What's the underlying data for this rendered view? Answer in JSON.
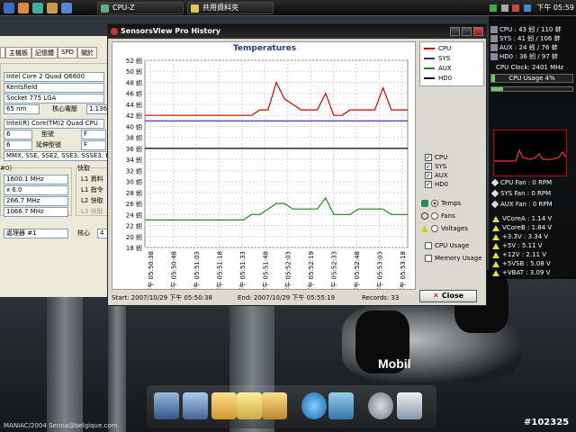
{
  "taskbar": {
    "tasks": [
      {
        "label": "CPU-Z"
      },
      {
        "label": "共用資料夾"
      }
    ],
    "clock": "下午 05:59"
  },
  "cpuz": {
    "tabs": [
      "主機板",
      "記憶體",
      "SPD",
      "關於"
    ],
    "name": "Intel Core 2 Quad Q6600",
    "codename": "Kentsfield",
    "package": "Socket 775 LGA",
    "technology": "65 nm",
    "voltage_label": "核心電壓",
    "voltage": "1.136",
    "spec": "Intel(R) Core(TM)2 Quad CPU",
    "family": "6",
    "model_label": "型號",
    "model": "F",
    "ext_family": "6",
    "ext_model_label": "延伸型號",
    "ext_model": "F",
    "instructions": "MMX, SSE, SSE2, SSE3, SSSE3, EM",
    "group_clocks": "#0)",
    "group_cache": "快取",
    "core_speed": "1600.1 MHz",
    "multiplier": "x 6.0",
    "bus_speed": "266.7 MHz",
    "rated_fsb": "1066.7 MHz",
    "l1_data_label": "L1 資料",
    "l1_inst_label": "L1 指令",
    "l2_label": "L2 快取",
    "l3_label": "L3 快取",
    "processor_select": "處理器 #1",
    "cores_label": "核心",
    "cores_value": "4"
  },
  "sensorsview": {
    "title": "SensorsView Pro History",
    "chart_title": "Temperatures",
    "legend": [
      "CPU",
      "SYS",
      "AUX",
      "HD0"
    ],
    "checks": [
      "CPU",
      "SYS",
      "AUX",
      "HD0"
    ],
    "radios": [
      "Temps",
      "Fans",
      "Voltages"
    ],
    "options": [
      "CPU Usage",
      "Memory Usage"
    ],
    "close_label": "Close",
    "start_label": "Start: 2007/10/29 下午 05:50:38",
    "end_label": "End: 2007/10/29 下午 05:55:19",
    "records_label": "Records: 33"
  },
  "chart_data": {
    "type": "line",
    "title": "Temperatures",
    "ylim": [
      18,
      52
    ],
    "y_ticks": [
      "52 蚓",
      "50 蚓",
      "48 蚓",
      "46 蚓",
      "44 蚓",
      "42 蚓",
      "40 蚓",
      "38 蚓",
      "36 蚓",
      "34 蚓",
      "32 蚓",
      "30 蚓",
      "28 蚓",
      "26 蚓",
      "24 蚓",
      "22 蚓",
      "20 蚓",
      "18 蚓"
    ],
    "x_ticks": [
      "下午 05:50:38",
      "下午 05:50:48",
      "下午 05:51:03",
      "下午 05:51:18",
      "下午 05:51:33",
      "下午 05:51:48",
      "下午 05:52:03",
      "下午 05:52:19",
      "下午 05:52:33",
      "下午 05:52:48",
      "下午 05:53:03",
      "下午 05:53:18"
    ],
    "series": [
      {
        "name": "CPU",
        "color": "#cc0000",
        "values": [
          42,
          42,
          42,
          42,
          42,
          42,
          42,
          42,
          42,
          42,
          42,
          42,
          42,
          42,
          43,
          43,
          48,
          45,
          44,
          43,
          43,
          43,
          46,
          42,
          42,
          43,
          43,
          43,
          43,
          47,
          43,
          43,
          43
        ]
      },
      {
        "name": "SYS",
        "color": "#2a2ab0",
        "values": [
          41,
          41,
          41,
          41,
          41,
          41,
          41,
          41,
          41,
          41,
          41,
          41,
          41,
          41,
          41,
          41,
          41,
          41,
          41,
          41,
          41,
          41,
          41,
          41,
          41,
          41,
          41,
          41,
          41,
          41,
          41,
          41,
          41
        ]
      },
      {
        "name": "AUX",
        "color": "#1a8a1a",
        "values": [
          23,
          23,
          23,
          23,
          23,
          23,
          23,
          23,
          23,
          23,
          23,
          23,
          23,
          24,
          24,
          25,
          26,
          26,
          25,
          25,
          25,
          25,
          27,
          24,
          24,
          24,
          25,
          25,
          25,
          25,
          24,
          24,
          24
        ]
      },
      {
        "name": "HD0",
        "color": "#000000",
        "values": [
          36,
          36,
          36,
          36,
          36,
          36,
          36,
          36,
          36,
          36,
          36,
          36,
          36,
          36,
          36,
          36,
          36,
          36,
          36,
          36,
          36,
          36,
          36,
          36,
          36,
          36,
          36,
          36,
          36,
          36,
          36,
          36,
          36
        ]
      }
    ]
  },
  "gadget": {
    "temps": [
      {
        "label": "CPU :",
        "value": "43 蚓 / 110 蚌"
      },
      {
        "label": "SYS :",
        "value": "41 蚓 / 106 蚌"
      },
      {
        "label": "AUX :",
        "value": "24 蚓 / 76 蚌"
      },
      {
        "label": "HD0 :",
        "value": "36 蚓 / 97 蚌"
      }
    ],
    "clock": "CPU Clock: 2401 MHz",
    "usage": "CPU Usage 4%",
    "usage_fraction": 0.04,
    "fans": [
      {
        "label": "CPU Fan :",
        "value": "0 RPM"
      },
      {
        "label": "SYS Fan :",
        "value": "0 RPM"
      },
      {
        "label": "AUX Fan :",
        "value": "0 RPM"
      }
    ],
    "volts": [
      {
        "label": "VCoreA :",
        "value": "1.14 V"
      },
      {
        "label": "VCoreB :",
        "value": "1.84 V"
      },
      {
        "label": "+3.3V :",
        "value": "3.34 V"
      },
      {
        "label": "+5V :",
        "value": "5.11 V"
      },
      {
        "label": "+12V :",
        "value": "2.11 V"
      },
      {
        "label": "+5VSB :",
        "value": "5.08 V"
      },
      {
        "label": "+VBAT :",
        "value": "3.09 V"
      }
    ]
  },
  "desktop": {
    "credit": "MANIAC/2004  Senna@belgique.com",
    "post_id": "#102325",
    "brand": "Mobil"
  }
}
